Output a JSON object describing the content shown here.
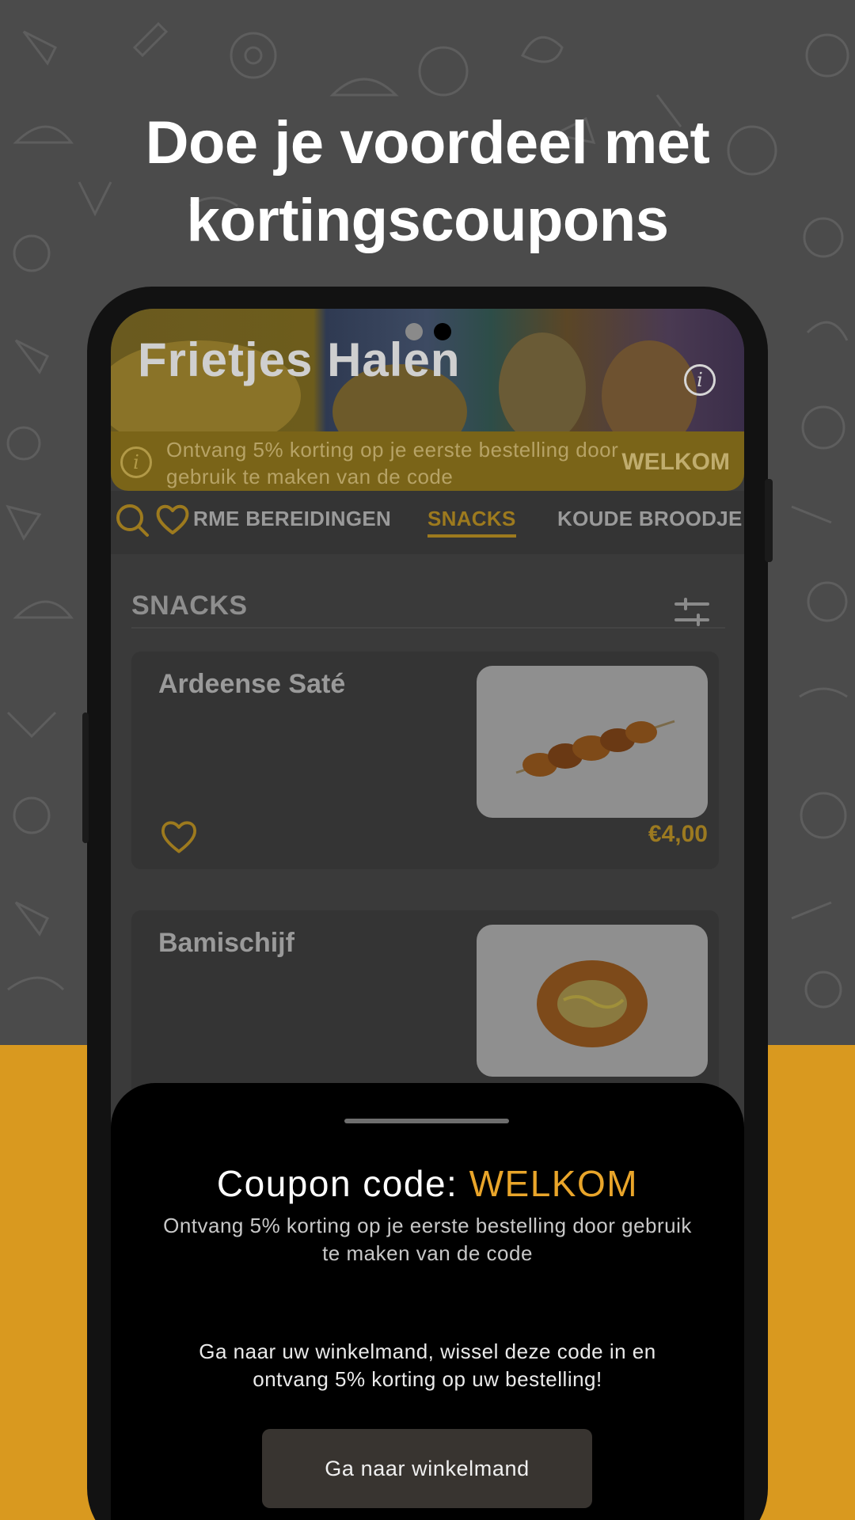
{
  "headline": {
    "line1": "Doe je voordeel met",
    "line2": "kortingscoupons"
  },
  "colors": {
    "accent": "#e9a52a",
    "background_yellow": "#d9991f",
    "sheet": "#000000",
    "button": "#383430"
  },
  "restaurant": {
    "name": "Frietjes Halen",
    "info_icon": "info-icon"
  },
  "promo_banner": {
    "text": "Ontvang 5% korting op je eerste bestelling door gebruik te maken van de code",
    "code": "WELKOM"
  },
  "tabs": {
    "items": [
      {
        "label": "RME BEREIDINGEN"
      },
      {
        "label": "SNACKS"
      },
      {
        "label": "KOUDE BROODJE"
      }
    ],
    "active": "SNACKS"
  },
  "section": {
    "title": "SNACKS"
  },
  "products": [
    {
      "name": "Ardeense Saté",
      "price": "€4,00"
    },
    {
      "name": "Bamischijf",
      "price": ""
    }
  ],
  "coupon_sheet": {
    "title_prefix": "Coupon code: ",
    "code": "WELKOM",
    "description": "Ontvang 5% korting op je eerste bestelling door gebruik te maken van de code",
    "instructions": "Ga naar uw winkelmand, wissel deze code in en ontvang 5% korting op uw bestelling!",
    "button_label": "Ga naar winkelmand"
  }
}
